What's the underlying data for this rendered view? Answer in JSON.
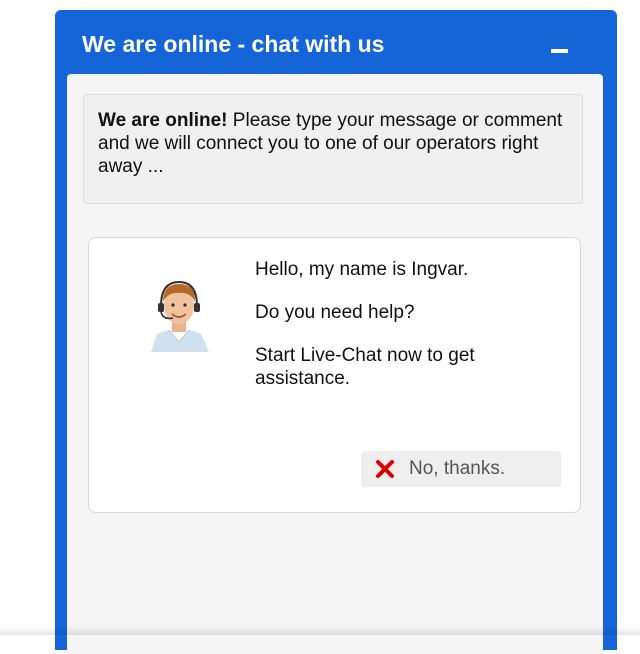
{
  "header": {
    "title": "We are online - chat with us",
    "minimize_icon": "minimize-icon"
  },
  "notice": {
    "bold": "We are online!",
    "text": " Please type your message or comment and we will connect you to one of our operators right away ..."
  },
  "operator": {
    "greeting": "Hello, my name is Ingvar.",
    "question": "Do you need help?",
    "invite": "Start Live-Chat now to get assistance.",
    "dismiss_label": "No, thanks.",
    "dismiss_icon": "close-x-icon"
  },
  "colors": {
    "brand": "#1565d8",
    "dismiss_icon": "#dd0000"
  }
}
